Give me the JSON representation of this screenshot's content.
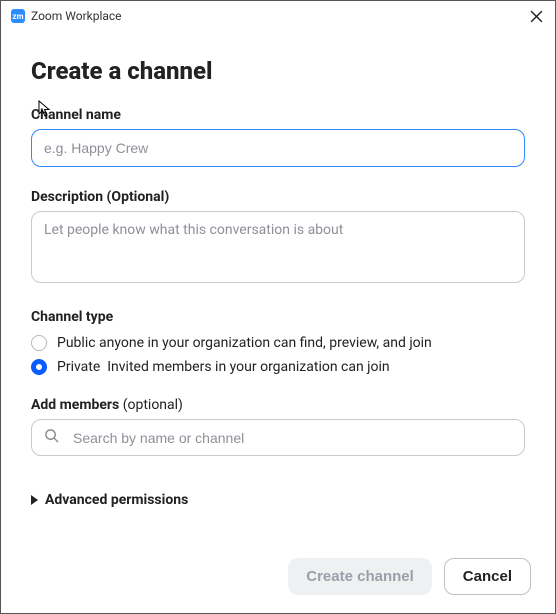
{
  "titlebar": {
    "app_icon_text": "zm",
    "title": "Zoom Workplace"
  },
  "header": {
    "title": "Create a channel"
  },
  "channel_name": {
    "label": "Channel name",
    "placeholder": "e.g. Happy Crew",
    "value": ""
  },
  "description": {
    "label": "Description (Optional)",
    "placeholder": "Let people know what this conversation is about",
    "value": ""
  },
  "channel_type": {
    "label": "Channel type",
    "options": [
      {
        "name": "Public",
        "desc": "anyone in your organization can find, preview, and join",
        "selected": false
      },
      {
        "name": "Private",
        "desc": "Invited members in your organization can join",
        "selected": true
      }
    ]
  },
  "add_members": {
    "label": "Add members",
    "optional": "(optional)",
    "placeholder": "Search by name or channel"
  },
  "advanced": {
    "label": "Advanced permissions"
  },
  "footer": {
    "create_label": "Create channel",
    "cancel_label": "Cancel"
  }
}
